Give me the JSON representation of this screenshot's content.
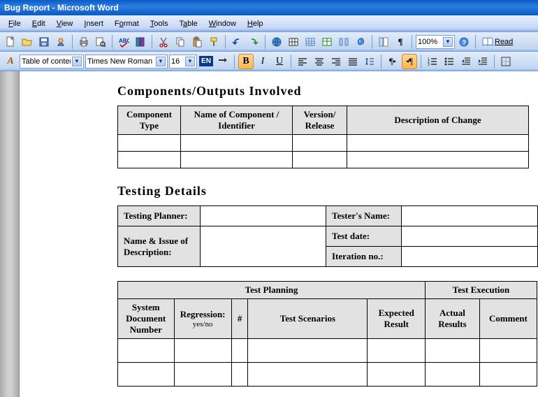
{
  "window": {
    "title": "Bug Report - Microsoft Word"
  },
  "menu": {
    "file": "File",
    "edit": "Edit",
    "view": "View",
    "insert": "Insert",
    "format": "Format",
    "tools": "Tools",
    "table": "Table",
    "window": "Window",
    "help": "Help"
  },
  "toolbar": {
    "zoom": "100%",
    "read": "Read",
    "style": "Table of conter",
    "font": "Times New Roman",
    "size": "16",
    "lang": "EN",
    "aa": "A"
  },
  "doc": {
    "h1": "Components/Outputs Involved",
    "t1": {
      "c1": "Component Type",
      "c2": "Name of Component / Identifier",
      "c3": "Version/ Release",
      "c4": "Description of Change"
    },
    "h2": "Testing Details",
    "t2": {
      "r1a": "Testing Planner:",
      "r1b": "Tester's Name:",
      "r2a": "Name & Issue of Description:",
      "r2b": "Test date:",
      "r2c": "Iteration no.:"
    },
    "t3": {
      "g1": "Test Planning",
      "g2": "Test Execution",
      "c1": "System Document Number",
      "c2": "Regression:",
      "c2sub": "yes/no",
      "c3": "#",
      "c4": "Test Scenarios",
      "c5": "Expected Result",
      "c6": "Actual Results",
      "c7": "Comment"
    }
  }
}
